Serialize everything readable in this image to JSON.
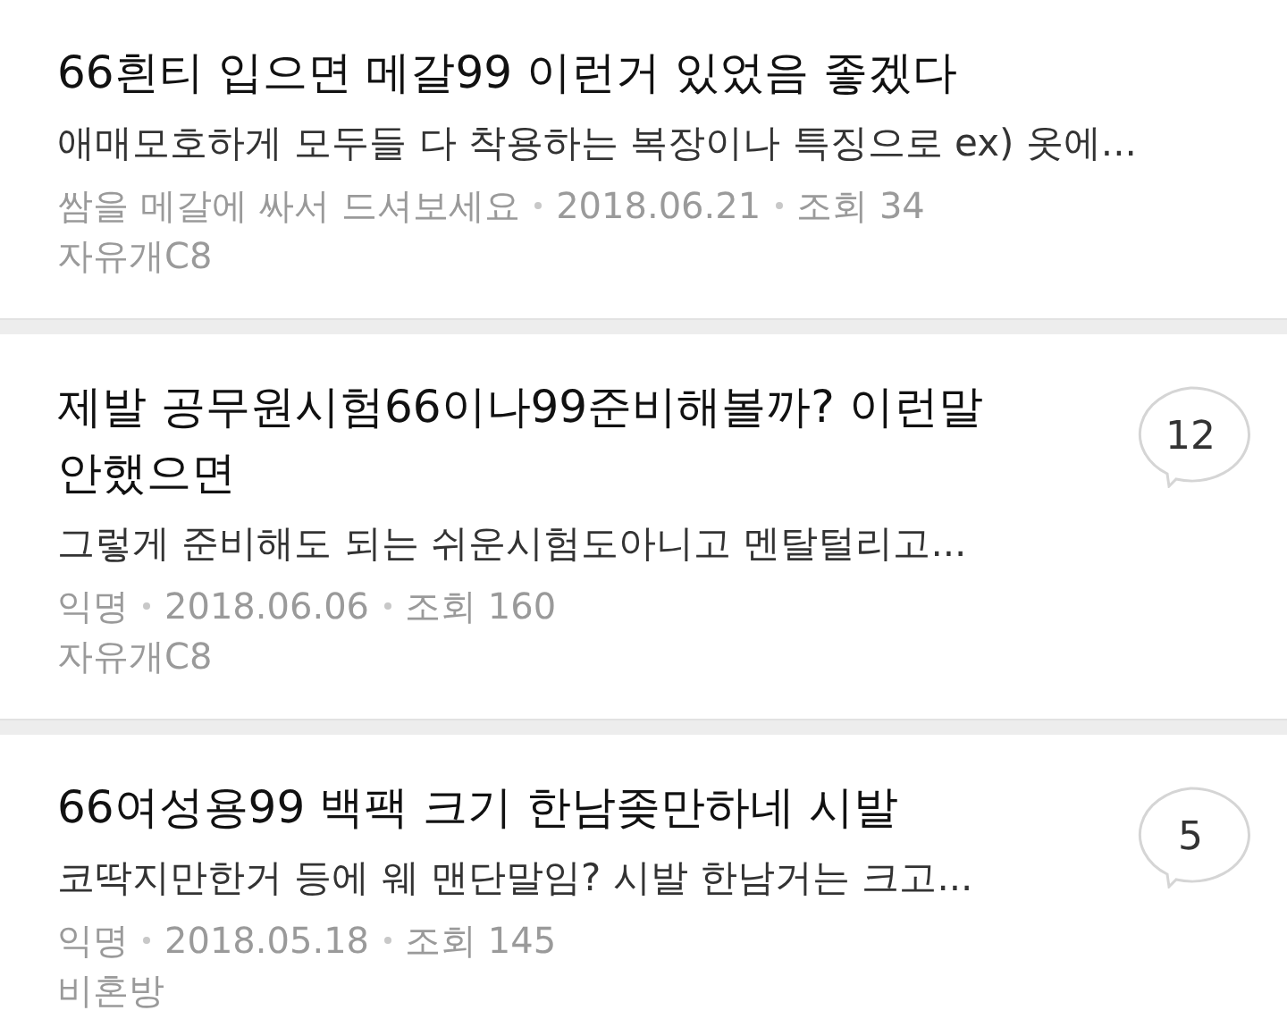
{
  "posts": [
    {
      "title": "66흰티 입으면 메갈99 이런거 있었음 좋겠다",
      "snippet": "애매모호하게 모두들 다 착용하는 복장이나 특징으로 ex) 옷에...",
      "author": "쌈을 메갈에 싸서 드셔보세요",
      "date": "2018.06.21",
      "views": "조회 34",
      "board": "자유개C8"
    },
    {
      "title": "제발 공무원시험66이나99준비해볼까? 이런말 안했으면",
      "snippet": "그렇게 준비해도 되는 쉬운시험도아니고 멘탈털리고...",
      "author": "익명",
      "date": "2018.06.06",
      "views": "조회 160",
      "board": "자유개C8",
      "comments": "12"
    },
    {
      "title": "66여성용99 백팩 크기 한남좆만하네 시발",
      "snippet": "코딱지만한거 등에 웨 맨단말임? 시발 한남거는 크고...",
      "author": "익명",
      "date": "2018.05.18",
      "views": "조회 145",
      "board": "비혼방",
      "comments": "5"
    }
  ]
}
